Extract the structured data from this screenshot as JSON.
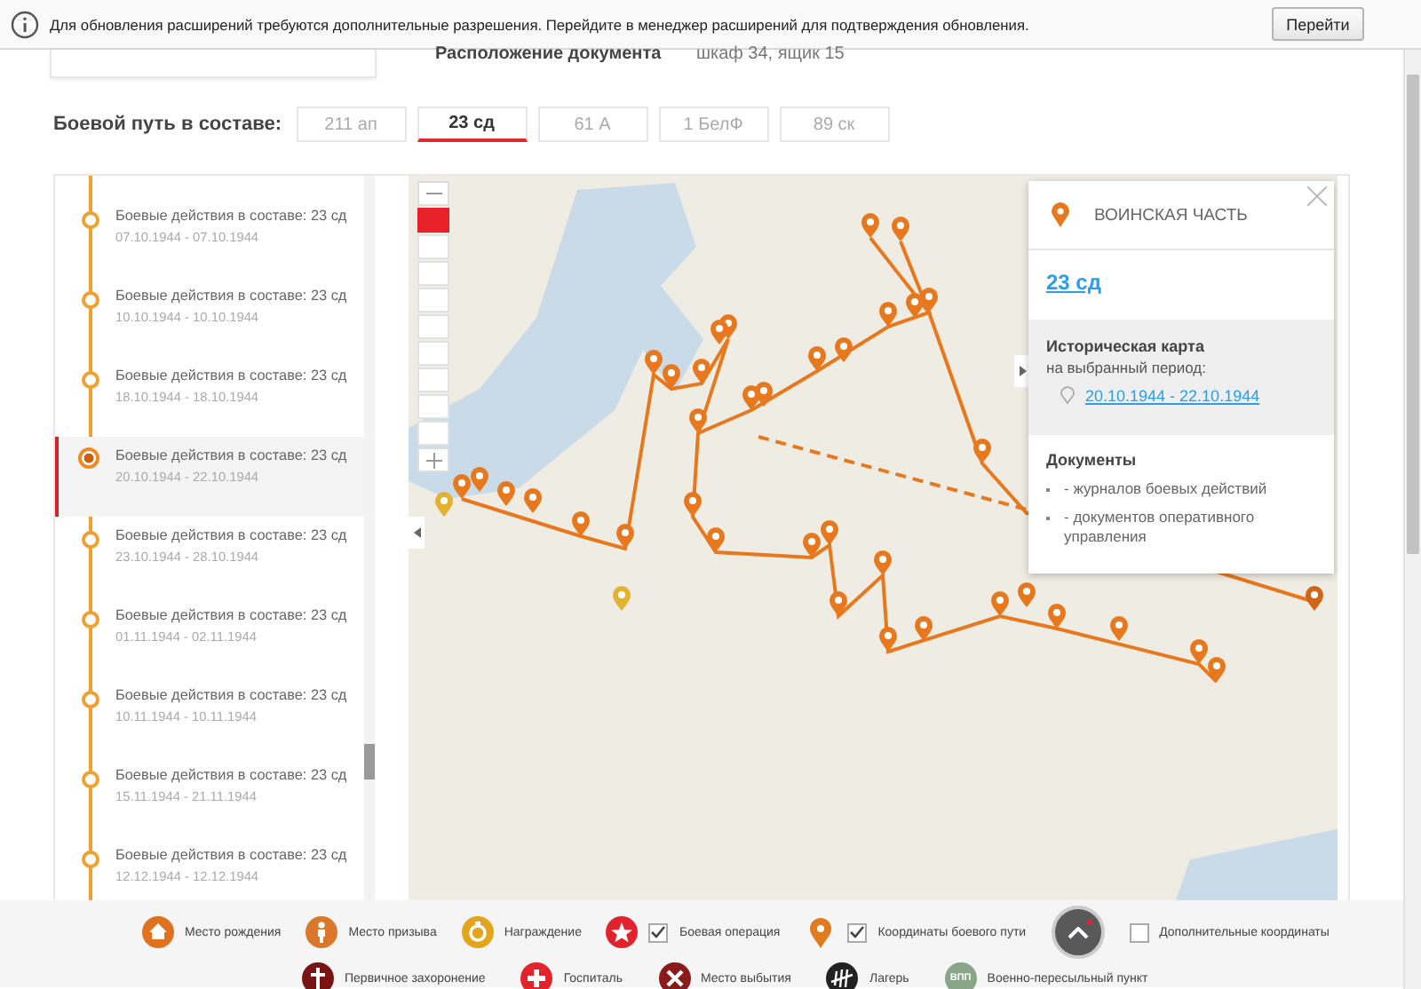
{
  "notification": {
    "message": "Для обновления расширений требуются дополнительные разрешения. Перейдите в менеджер расширений для подтверждения обновления.",
    "button": "Перейти"
  },
  "document": {
    "label": "Расположение документа",
    "value": "шкаф 34, ящик 15"
  },
  "combat_path": {
    "label": "Боевой путь в составе:",
    "tabs": [
      {
        "label": "211 ап",
        "selected": false
      },
      {
        "label": "23 сд",
        "selected": true
      },
      {
        "label": "61 А",
        "selected": false
      },
      {
        "label": "1 БелФ",
        "selected": false
      },
      {
        "label": "89 ск",
        "selected": false
      }
    ]
  },
  "timeline": [
    {
      "title": "Боевые действия в составе: 23 сд",
      "dates": "07.10.1944 - 07.10.1944",
      "selected": false
    },
    {
      "title": "Боевые действия в составе: 23 сд",
      "dates": "10.10.1944 - 10.10.1944",
      "selected": false
    },
    {
      "title": "Боевые действия в составе: 23 сд",
      "dates": "18.10.1944 - 18.10.1944",
      "selected": false
    },
    {
      "title": "Боевые действия в составе: 23 сд",
      "dates": "20.10.1944 - 22.10.1944",
      "selected": true
    },
    {
      "title": "Боевые действия в составе: 23 сд",
      "dates": "23.10.1944 - 28.10.1944",
      "selected": false
    },
    {
      "title": "Боевые действия в составе: 23 сд",
      "dates": "01.11.1944 - 02.11.1944",
      "selected": false
    },
    {
      "title": "Боевые действия в составе: 23 сд",
      "dates": "10.11.1944 - 10.11.1944",
      "selected": false
    },
    {
      "title": "Боевые действия в составе: 23 сд",
      "dates": "15.11.1944 - 21.11.1944",
      "selected": false
    },
    {
      "title": "Боевые действия в составе: 23 сд",
      "dates": "12.12.1944 - 12.12.1944",
      "selected": false
    }
  ],
  "map": {
    "zoom": {
      "level": 0
    }
  },
  "popup": {
    "category": "ВОИНСКАЯ ЧАСТЬ",
    "unit_link": "23 сд",
    "historical_map": {
      "title": "Историческая карта",
      "subtitle": "на выбранный период:",
      "period_link": "20.10.1944 - 22.10.1944"
    },
    "documents": {
      "title": "Документы",
      "items": [
        "- журналов боевых действий",
        "- документов оперативного управления"
      ]
    }
  },
  "legend": {
    "row_1": [
      {
        "kind": "house",
        "label": "Место рождения",
        "color": "#e0711f"
      },
      {
        "kind": "person",
        "label": "Место призыва",
        "color": "#d9772b"
      },
      {
        "kind": "medal",
        "label": "Награждение",
        "color": "#e3a51c"
      },
      {
        "kind": "star",
        "label": "Боевая операция",
        "color": "#e3232c",
        "checked": true
      },
      {
        "kind": "pin",
        "label": "Координаты боевого пути",
        "color": "#e07b20",
        "checked": true
      },
      {
        "kind": "scroll",
        "label": "Дополнительные координаты",
        "checked": false
      }
    ],
    "row_2": [
      {
        "kind": "cross",
        "label": "Первичное захоронение",
        "color": "#7a1414"
      },
      {
        "kind": "plus",
        "label": "Госпиталь",
        "color": "#e3232c"
      },
      {
        "kind": "x",
        "label": "Место выбытия",
        "color": "#8b1a1a"
      },
      {
        "kind": "camp",
        "label": "Лагерь",
        "color": "#222222"
      },
      {
        "kind": "badge",
        "label": "Военно-пересыльный пункт",
        "color": "#8aa68a",
        "icon_text": "ВПП"
      }
    ]
  }
}
